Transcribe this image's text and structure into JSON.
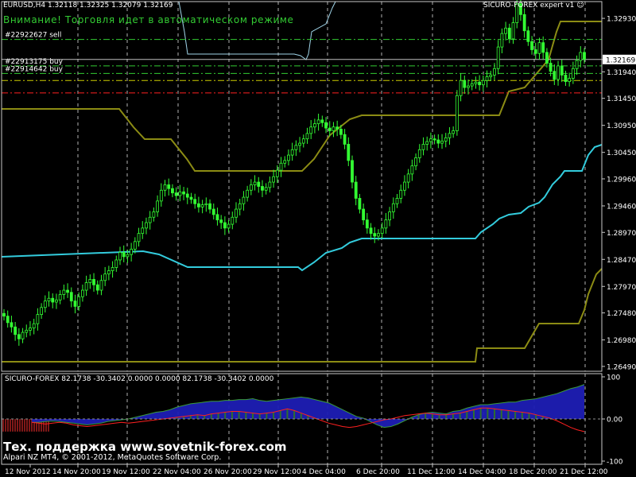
{
  "header": {
    "symbol_line": "EURUSD,H4  1.32118 1.32325 1.32079 1.32169",
    "expert_label": "SICURO-FOREX expert v1 ☺",
    "warning": "Внимание! Торговля идет в автоматическом режиме"
  },
  "orders": [
    {
      "label": "#22922627 sell",
      "price": 1.3254,
      "color": "#33cc33",
      "style": "dashdot"
    },
    {
      "label": "#22913175 buy",
      "price": 1.3205,
      "color": "#33cc33",
      "style": "dashdot"
    },
    {
      "label": "#22914642 buy",
      "price": 1.3191,
      "color": "#33cc33",
      "style": "dashdot"
    },
    {
      "label": "",
      "price": 1.3178,
      "color": "#cccc00",
      "style": "dashdot"
    },
    {
      "label": "",
      "price": 1.3155,
      "color": "#ff2020",
      "style": "dashdot"
    }
  ],
  "current_price_label": "1.32169",
  "footer": {
    "support": "Тех. поддержка www.sovetnik-forex.com",
    "copyright": "Alpari NZ MT4, © 2001-2012, MetaQuotes Software Corp."
  },
  "colors": {
    "background": "#000000",
    "bull_candle": "#33ff33",
    "bear_candle": "#33ff33",
    "channel_outer": "#8c8c14",
    "channel_inner": "#33ccdd",
    "grid": "#b0b0b0",
    "indicator_blue": "#1e1eb4",
    "indicator_green": "#2e6e2e",
    "indicator_red": "#ff2020",
    "hist_red": "#ff3030"
  },
  "chart_data": [
    {
      "type": "candlestick",
      "title": "EURUSD,H4",
      "ylim": [
        1.264,
        1.3324
      ],
      "y_ticks": [
        "1.32930",
        "1.32169",
        "1.31940",
        "1.31450",
        "1.30950",
        "1.30450",
        "1.29960",
        "1.29460",
        "1.28970",
        "1.28470",
        "1.27970",
        "1.27480",
        "1.26980",
        "1.26490"
      ],
      "x_ticks": [
        "12 Nov 2012",
        "14 Nov 20:00",
        "19 Nov 12:00",
        "22 Nov 04:00",
        "26 Nov 20:00",
        "29 Nov 12:00",
        "4 Dec 04:00",
        "6 Dec 20:00",
        "11 Dec 12:00",
        "14 Dec 04:00",
        "18 Dec 20:00",
        "21 Dec 12:00"
      ],
      "close_series": [
        1.2742,
        1.273,
        1.2722,
        1.2708,
        1.27,
        1.2712,
        1.2716,
        1.272,
        1.2728,
        1.2745,
        1.2758,
        1.277,
        1.2775,
        1.2768,
        1.2772,
        1.2782,
        1.279,
        1.2786,
        1.277,
        1.276,
        1.2778,
        1.279,
        1.2804,
        1.281,
        1.28,
        1.279,
        1.2808,
        1.282,
        1.2826,
        1.2832,
        1.2846,
        1.286,
        1.2852,
        1.2856,
        1.2866,
        1.288,
        1.2895,
        1.2905,
        1.2915,
        1.2925,
        1.2935,
        1.2955,
        1.2975,
        1.2985,
        1.2978,
        1.297,
        1.2965,
        1.2972,
        1.2968,
        1.2962,
        1.2958,
        1.295,
        1.2944,
        1.2948,
        1.295,
        1.294,
        1.293,
        1.292,
        1.2915,
        1.2905,
        1.2912,
        1.2925,
        1.294,
        1.295,
        1.2962,
        1.2975,
        1.2985,
        1.299,
        1.2982,
        1.2975,
        1.298,
        1.299,
        1.3,
        1.3012,
        1.3025,
        1.303,
        1.304,
        1.305,
        1.3058,
        1.3062,
        1.307,
        1.308,
        1.3092,
        1.3098,
        1.3105,
        1.31,
        1.309,
        1.3085,
        1.3092,
        1.3088,
        1.3078,
        1.306,
        1.303,
        1.299,
        1.296,
        1.294,
        1.292,
        1.2905,
        1.2895,
        1.289,
        1.2895,
        1.2905,
        1.292,
        1.2935,
        1.295,
        1.296,
        1.2975,
        1.299,
        1.3005,
        1.302,
        1.3035,
        1.305,
        1.306,
        1.3065,
        1.307,
        1.3068,
        1.3062,
        1.3066,
        1.3072,
        1.308,
        1.3085,
        1.315,
        1.3178,
        1.3165,
        1.3168,
        1.3172,
        1.3175,
        1.317,
        1.3178,
        1.3185,
        1.3188,
        1.32,
        1.324,
        1.3265,
        1.3275,
        1.3255,
        1.3285,
        1.332,
        1.33,
        1.327,
        1.325,
        1.3235,
        1.3228,
        1.3248,
        1.323,
        1.321,
        1.3195,
        1.318,
        1.3205,
        1.3188,
        1.3176,
        1.3182,
        1.32,
        1.3215,
        1.323,
        1.3217
      ]
    },
    {
      "type": "area",
      "title": "SICURO-FOREX 82.1738 -30.3402 0.0000 0.0000 82.1738 -30.3402 0.0000",
      "ylim": [
        -100,
        100
      ],
      "y_ticks": [
        "100",
        "0.00",
        "-100"
      ],
      "series": [
        {
          "name": "",
          "values": [
            -8,
            -8,
            -6,
            -5,
            -6,
            -8,
            -10,
            -12,
            -14,
            -12,
            -10,
            -6,
            -4,
            -2,
            0,
            4,
            8,
            12,
            16,
            18,
            22,
            28,
            32,
            36,
            38,
            40,
            42,
            42,
            44,
            44,
            46,
            46,
            48,
            44,
            42,
            44,
            46,
            48,
            50,
            52,
            50,
            46,
            42,
            38,
            30,
            22,
            14,
            6,
            2,
            -6,
            -14,
            -20,
            -18,
            -12,
            -4,
            4,
            10,
            14,
            16,
            14,
            12,
            18,
            20,
            26,
            30,
            34,
            34,
            36,
            38,
            40,
            40,
            44,
            46,
            48,
            52,
            56,
            60,
            66,
            72,
            76,
            82
          ]
        },
        {
          "name": "",
          "values": [
            -8,
            -10,
            -12,
            -10,
            -8,
            -10,
            -14,
            -16,
            -18,
            -16,
            -14,
            -12,
            -10,
            -8,
            -10,
            -8,
            -6,
            -4,
            -2,
            0,
            2,
            4,
            6,
            8,
            10,
            8,
            12,
            14,
            16,
            18,
            18,
            16,
            14,
            12,
            14,
            16,
            20,
            24,
            20,
            14,
            8,
            2,
            -4,
            -10,
            -14,
            -18,
            -20,
            -18,
            -14,
            -10,
            -6,
            -2,
            0,
            4,
            8,
            10,
            12,
            14,
            12,
            10,
            10,
            12,
            14,
            18,
            22,
            26,
            26,
            24,
            22,
            20,
            18,
            16,
            14,
            10,
            6,
            2,
            -4,
            -12,
            -20,
            -26,
            -30
          ]
        }
      ]
    }
  ]
}
